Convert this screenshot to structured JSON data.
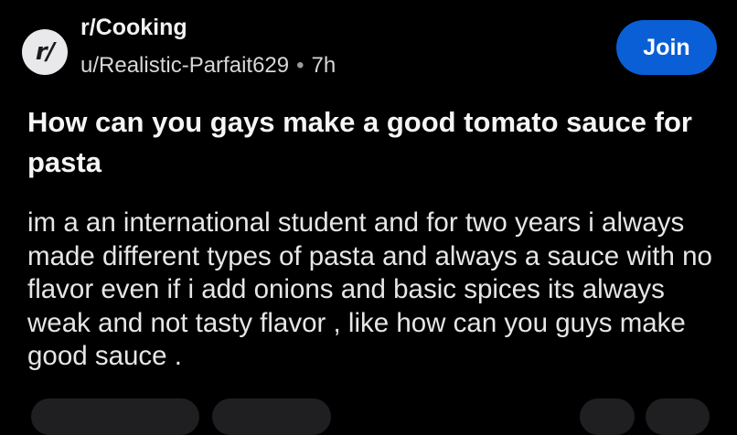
{
  "post": {
    "subreddit": "r/Cooking",
    "avatar_text": "r/",
    "author": "u/Realistic-Parfait629",
    "separator": "•",
    "time": "7h",
    "join_label": "Join",
    "title": "How can you gays make a good tomato sauce for pasta",
    "body": "im a an international student and for two years i always made different types of pasta and always a sauce with no flavor even if i add onions and basic spices its always weak and not tasty flavor , like how can you guys make good sauce ."
  },
  "colors": {
    "background": "#000000",
    "join_button": "#0a5fd6",
    "avatar_bg": "#e9e9ec"
  }
}
